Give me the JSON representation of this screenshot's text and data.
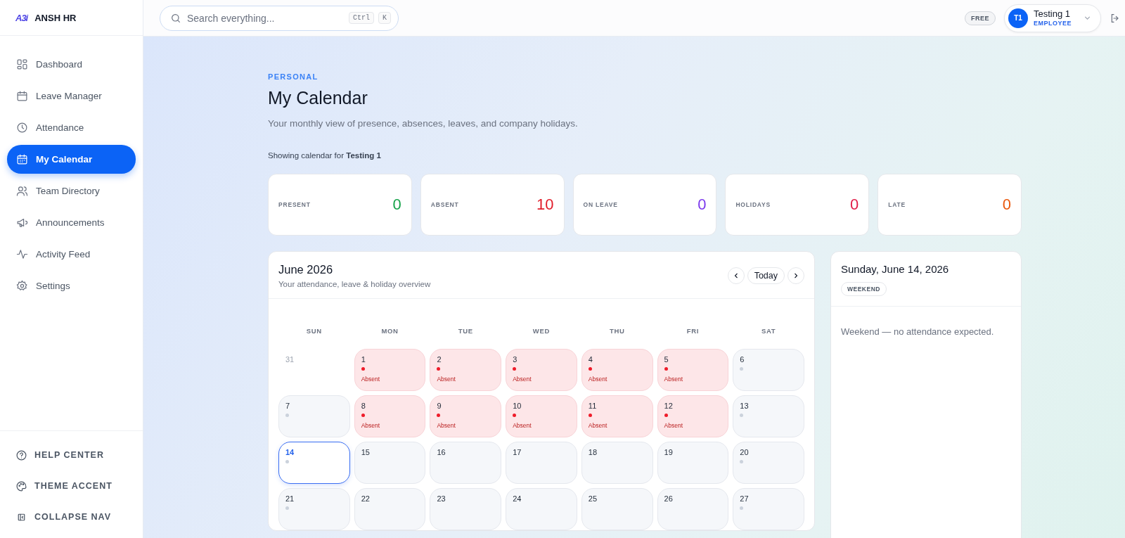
{
  "brand": {
    "logo": "A3i",
    "name": "ANSH HR"
  },
  "search": {
    "placeholder": "Search everything...",
    "keys": [
      "Ctrl",
      "K"
    ]
  },
  "topbar": {
    "plan": "FREE",
    "user": {
      "initials": "T1",
      "name": "Testing 1",
      "role": "EMPLOYEE"
    }
  },
  "sidebar": {
    "items": [
      {
        "label": "Dashboard",
        "selected": false
      },
      {
        "label": "Leave Manager",
        "selected": false
      },
      {
        "label": "Attendance",
        "selected": false
      },
      {
        "label": "My Calendar",
        "selected": true
      },
      {
        "label": "Team Directory",
        "selected": false
      },
      {
        "label": "Announcements",
        "selected": false
      },
      {
        "label": "Activity Feed",
        "selected": false
      },
      {
        "label": "Settings",
        "selected": false
      }
    ],
    "footer": [
      {
        "label": "HELP CENTER"
      },
      {
        "label": "THEME ACCENT"
      },
      {
        "label": "COLLAPSE NAV"
      }
    ]
  },
  "page": {
    "eyebrow": "PERSONAL",
    "title": "My Calendar",
    "subtitle": "Your monthly view of presence, absences, leaves, and company holidays.",
    "showing": "Showing calendar for **Testing 1**"
  },
  "stats": [
    {
      "label": "PRESENT",
      "value": "0",
      "color": "#16a34a"
    },
    {
      "label": "ABSENT",
      "value": "10",
      "color": "#e11d2a"
    },
    {
      "label": "ON LEAVE",
      "value": "0",
      "color": "#7c3aed"
    },
    {
      "label": "HOLIDAYS",
      "value": "0",
      "color": "#e11d48"
    },
    {
      "label": "LATE",
      "value": "0",
      "color": "#ea580c"
    }
  ],
  "calendar": {
    "title": "June 2026",
    "subtitle": "Your attendance, leave & holiday overview",
    "today": "Today",
    "weekdays": [
      "SUN",
      "MON",
      "TUE",
      "WED",
      "THU",
      "FRI",
      "SAT"
    ],
    "weeks": [
      [
        {
          "day": "31",
          "kind": "outside",
          "selected": false
        },
        {
          "day": "1",
          "kind": "absent",
          "label": "Absent",
          "selected": false
        },
        {
          "day": "2",
          "kind": "absent",
          "label": "Absent",
          "selected": false
        },
        {
          "day": "3",
          "kind": "absent",
          "label": "Absent",
          "selected": false
        },
        {
          "day": "4",
          "kind": "absent",
          "label": "Absent",
          "selected": false
        },
        {
          "day": "5",
          "kind": "absent",
          "label": "Absent",
          "selected": false
        },
        {
          "day": "6",
          "kind": "weekend",
          "selected": false
        }
      ],
      [
        {
          "day": "7",
          "kind": "weekend",
          "selected": false
        },
        {
          "day": "8",
          "kind": "absent",
          "label": "Absent",
          "selected": false
        },
        {
          "day": "9",
          "kind": "absent",
          "label": "Absent",
          "selected": false
        },
        {
          "day": "10",
          "kind": "absent",
          "label": "Absent",
          "selected": false
        },
        {
          "day": "11",
          "kind": "absent",
          "label": "Absent",
          "selected": false
        },
        {
          "day": "12",
          "kind": "absent",
          "label": "Absent",
          "selected": false
        },
        {
          "day": "13",
          "kind": "weekend",
          "selected": false
        }
      ],
      [
        {
          "day": "14",
          "kind": "weekend",
          "selected": true
        },
        {
          "day": "15",
          "kind": "normal",
          "selected": false
        },
        {
          "day": "16",
          "kind": "normal",
          "selected": false
        },
        {
          "day": "17",
          "kind": "normal",
          "selected": false
        },
        {
          "day": "18",
          "kind": "normal",
          "selected": false
        },
        {
          "day": "19",
          "kind": "normal",
          "selected": false
        },
        {
          "day": "20",
          "kind": "weekend",
          "selected": false
        }
      ],
      [
        {
          "day": "21",
          "kind": "weekend",
          "selected": false
        },
        {
          "day": "22",
          "kind": "normal",
          "selected": false
        },
        {
          "day": "23",
          "kind": "normal",
          "selected": false
        },
        {
          "day": "24",
          "kind": "normal",
          "selected": false
        },
        {
          "day": "25",
          "kind": "normal",
          "selected": false
        },
        {
          "day": "26",
          "kind": "normal",
          "selected": false
        },
        {
          "day": "27",
          "kind": "weekend",
          "selected": false
        }
      ]
    ]
  },
  "detail": {
    "title": "Sunday, June 14, 2026",
    "badge": "WEEKEND",
    "message": "Weekend — no attendance expected."
  }
}
